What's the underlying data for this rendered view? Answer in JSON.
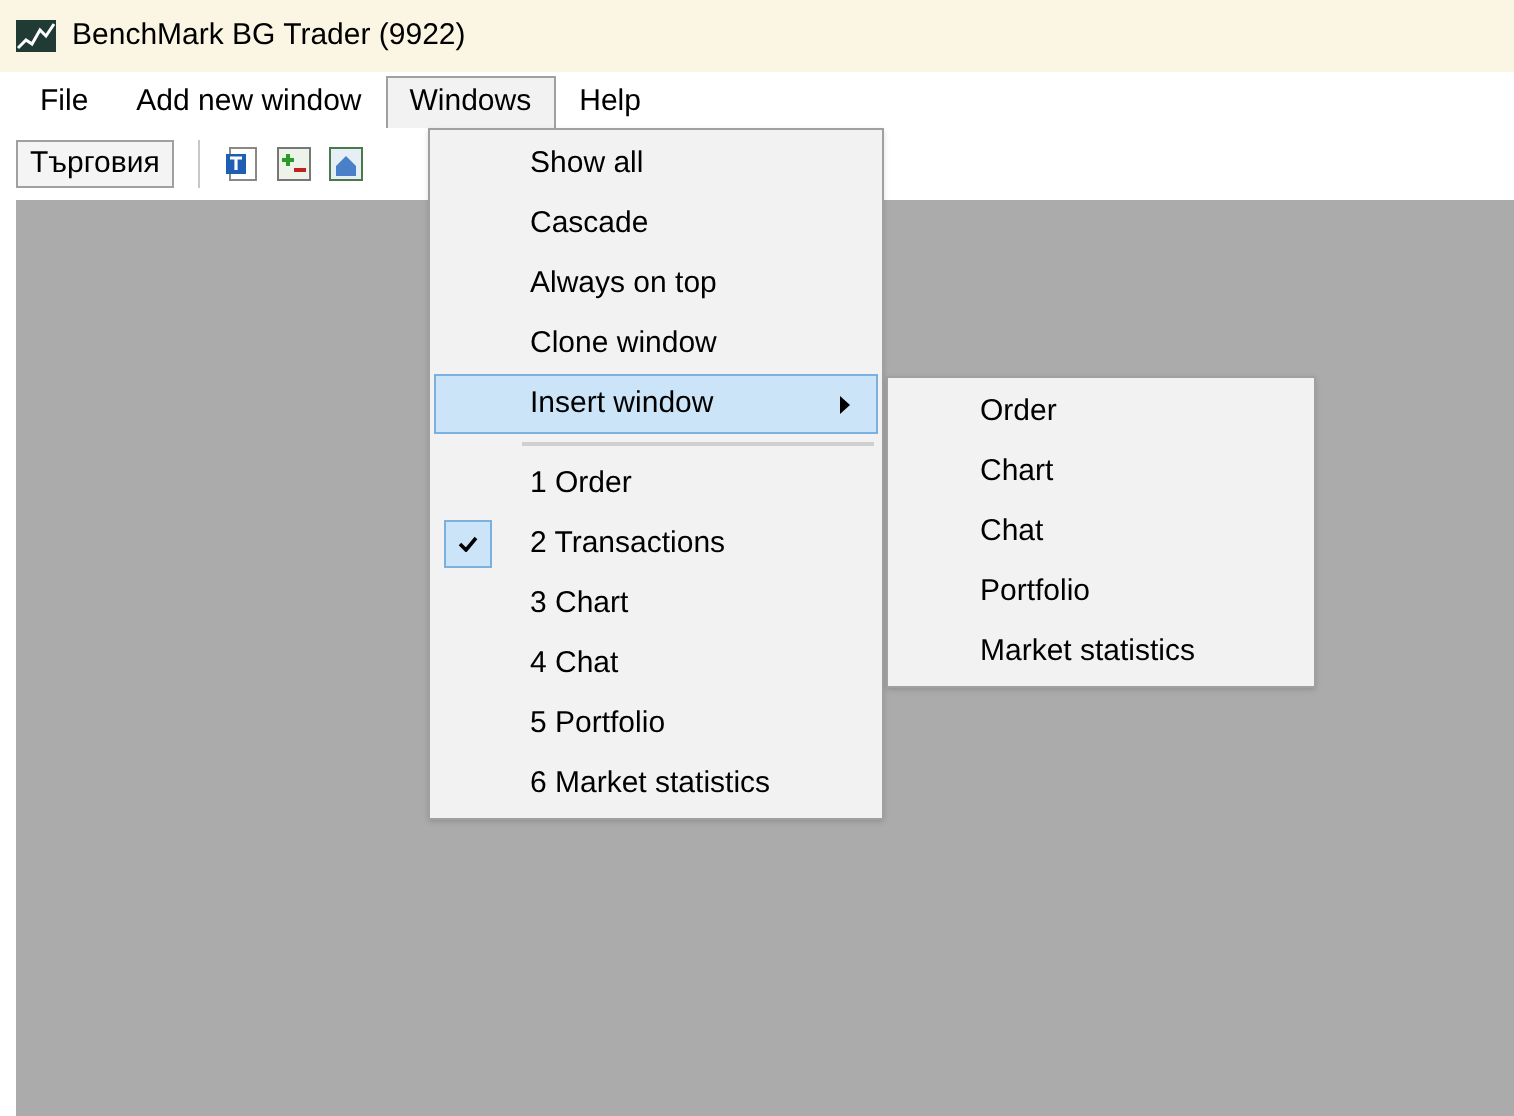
{
  "window": {
    "title": "BenchMark BG Trader (9922)"
  },
  "menu_bar": [
    {
      "label": "File",
      "selected": false
    },
    {
      "label": "Add new window",
      "selected": false
    },
    {
      "label": "Windows",
      "selected": true
    },
    {
      "label": "Help",
      "selected": false
    }
  ],
  "toolbar": {
    "tab": "Търговия"
  },
  "windows_menu": [
    {
      "kind": "item",
      "label": "Show all",
      "selected": false
    },
    {
      "kind": "item",
      "label": "Cascade",
      "selected": false
    },
    {
      "kind": "item",
      "label": "Always on top",
      "selected": false
    },
    {
      "kind": "item",
      "label": "Clone window",
      "selected": false
    },
    {
      "kind": "submenu",
      "label": "Insert window",
      "selected": true
    },
    {
      "kind": "separator"
    },
    {
      "kind": "window",
      "label": "1 Order",
      "checked": false,
      "selected": false
    },
    {
      "kind": "window",
      "label": "2 Transactions",
      "checked": true,
      "selected": false
    },
    {
      "kind": "window",
      "label": "3 Chart",
      "checked": false,
      "selected": false
    },
    {
      "kind": "window",
      "label": "4 Chat",
      "checked": false,
      "selected": false
    },
    {
      "kind": "window",
      "label": "5 Portfolio",
      "checked": false,
      "selected": false
    },
    {
      "kind": "window",
      "label": "6 Market statistics",
      "checked": false,
      "selected": false
    }
  ],
  "insert_submenu": [
    "Order",
    "Chart",
    "Chat",
    "Portfolio",
    "Market statistics"
  ]
}
